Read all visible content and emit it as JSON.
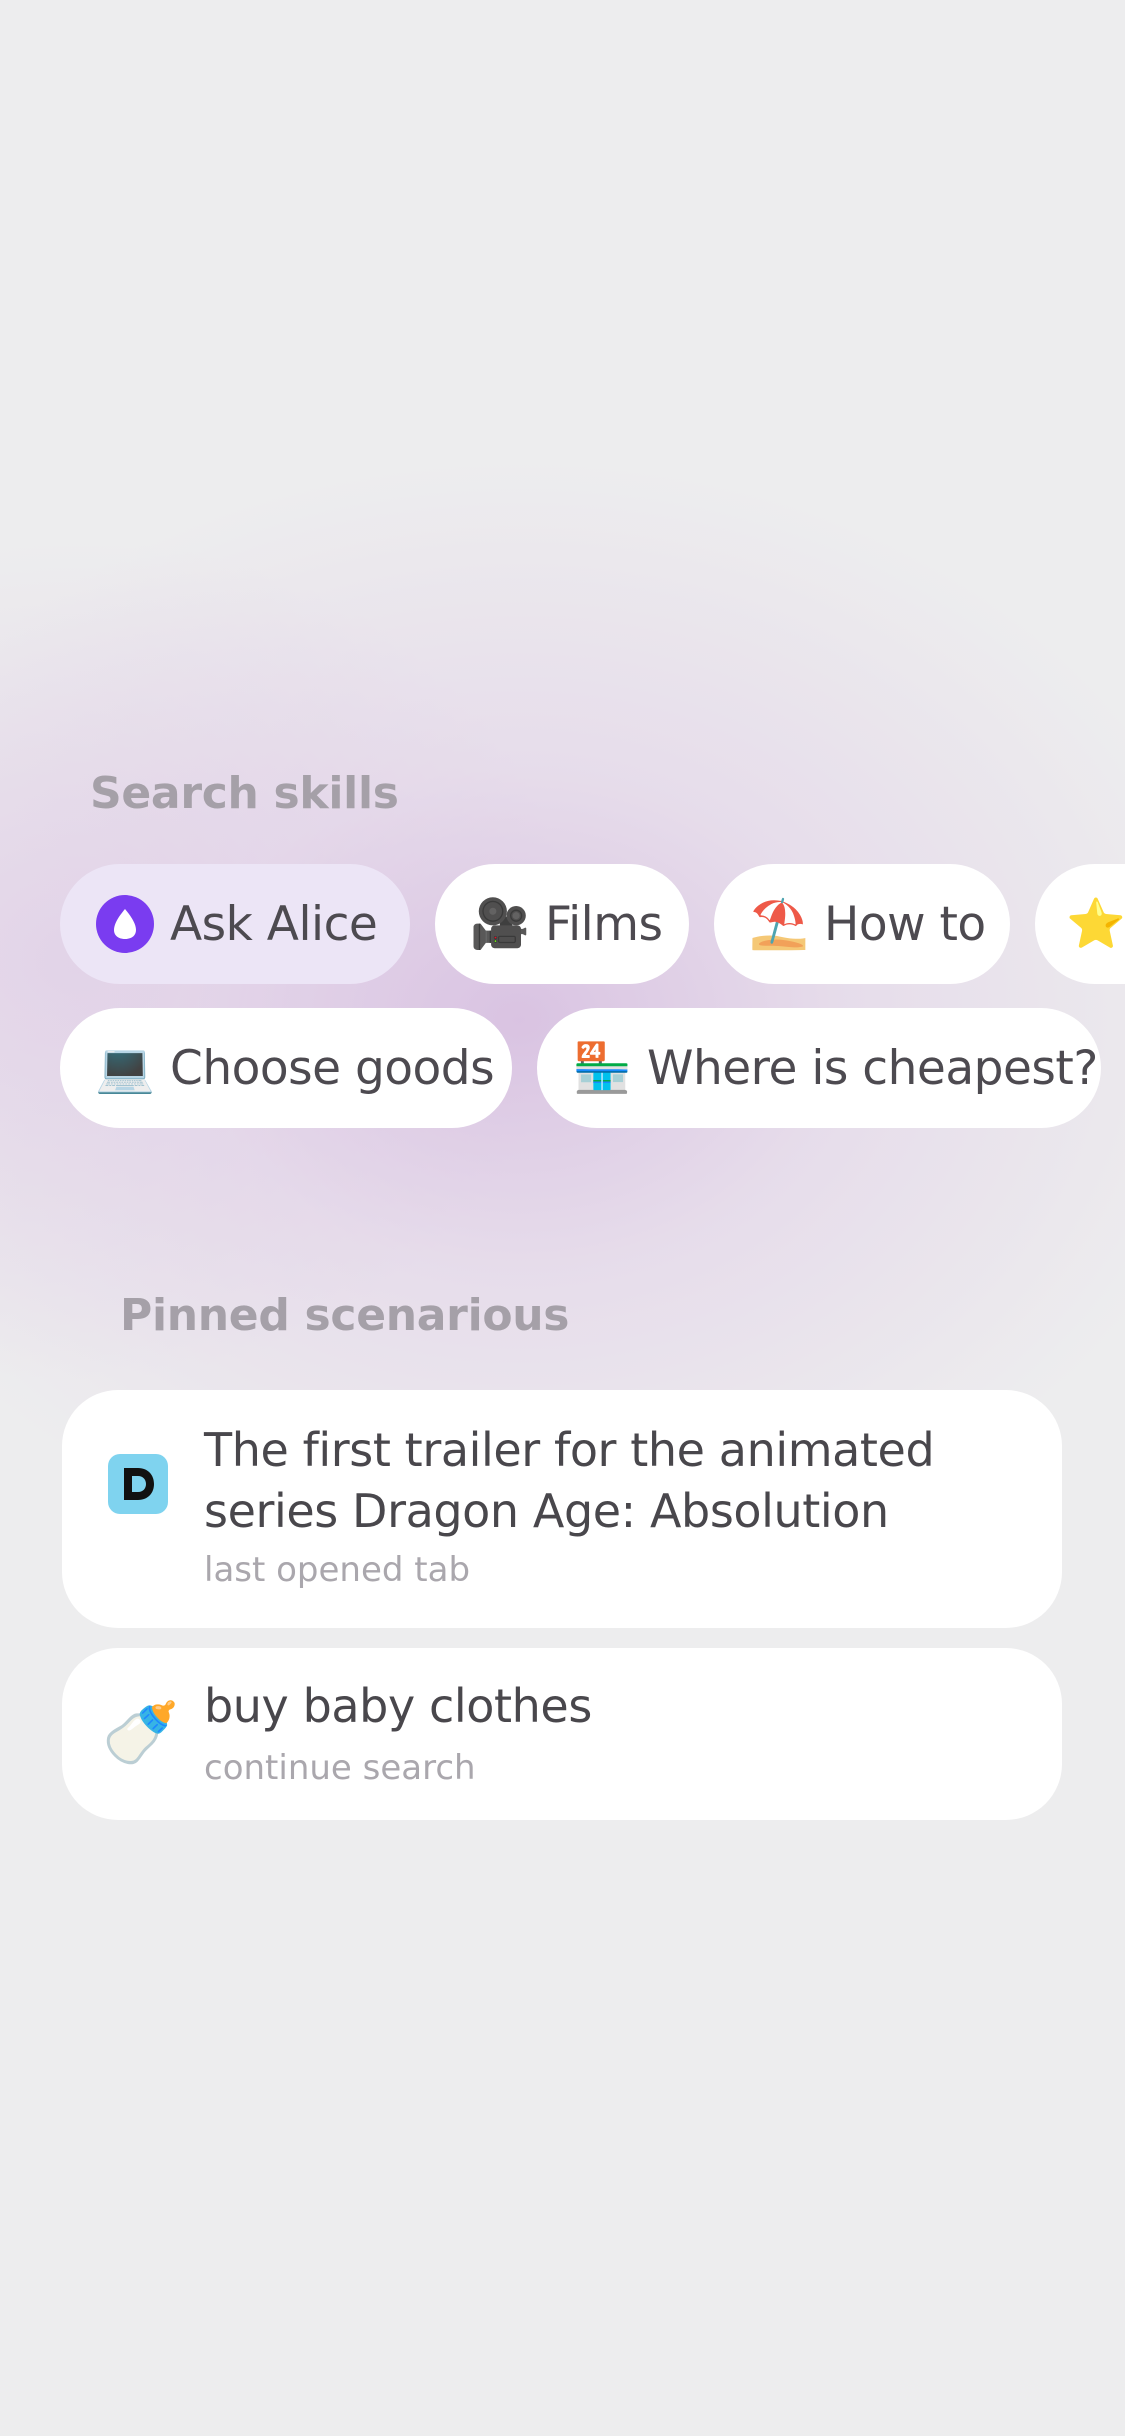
{
  "search_skills": {
    "title": "Search skills",
    "chips": [
      {
        "label": "Ask Alice",
        "icon": "alice-icon"
      },
      {
        "label": "Films",
        "icon": "movie-camera-icon"
      },
      {
        "label": "How to",
        "icon": "umbrella-icon"
      },
      {
        "label": "",
        "icon": "star-icon"
      },
      {
        "label": "Choose goods",
        "icon": "laptop-icon"
      },
      {
        "label": "Where is cheapest?",
        "icon": "store-24-icon"
      }
    ]
  },
  "pinned": {
    "title": "Pinned scenarious",
    "items": [
      {
        "title": "The first trailer for the animated series Dragon Age: Absolution",
        "subtitle": "last opened tab",
        "icon": "d-app-icon"
      },
      {
        "title": "buy baby clothes",
        "subtitle": "continue search",
        "icon": "baby-bottle-icon"
      }
    ]
  },
  "colors": {
    "alice_purple": "#7a3cf0",
    "chip_alice_bg": "#ece5f6",
    "text_primary": "#4d4a50",
    "text_muted": "#a5a0a8"
  }
}
